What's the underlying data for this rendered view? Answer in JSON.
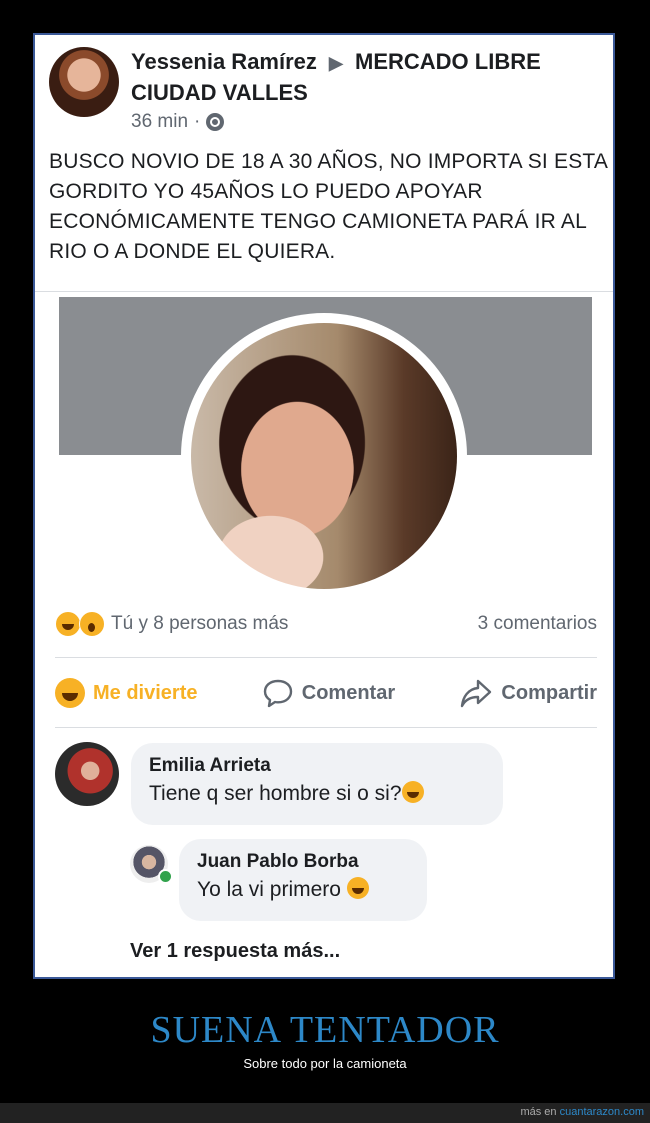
{
  "post": {
    "author": "Yessenia Ramírez",
    "arrow": "▶",
    "group": "MERCADO LIBRE CIUDAD VALLES",
    "time": "36 min",
    "dot": "·",
    "text": "BUSCO NOVIO DE 18 A 30 AÑOS, NO IMPORTA SI ESTA GORDITO YO 45AÑOS LO PUEDO APOYAR ECONÓMICAMENTE TENGO CAMIONETA PARÁ IR AL RIO O A DONDE EL QUIERA."
  },
  "reactions": {
    "summary": "Tú y 8 personas más",
    "comments": "3 comentarios"
  },
  "actions": {
    "react": "Me divierte",
    "comment": "Comentar",
    "share": "Compartir"
  },
  "comments": [
    {
      "name": "Emilia Arrieta",
      "text": "Tiene q ser hombre si o si?"
    },
    {
      "name": "Juan Pablo Borba",
      "text": "Yo la vi primero "
    }
  ],
  "more_replies": "Ver 1 respuesta más...",
  "caption": {
    "title": "SUENA TENTADOR",
    "subtitle": "Sobre todo por la camioneta"
  },
  "footer": {
    "prefix": "más en ",
    "site": "cuantarazon.com"
  },
  "colors": {
    "accent": "#2d88c8",
    "haha": "#f7b125",
    "online": "#31a24c"
  }
}
